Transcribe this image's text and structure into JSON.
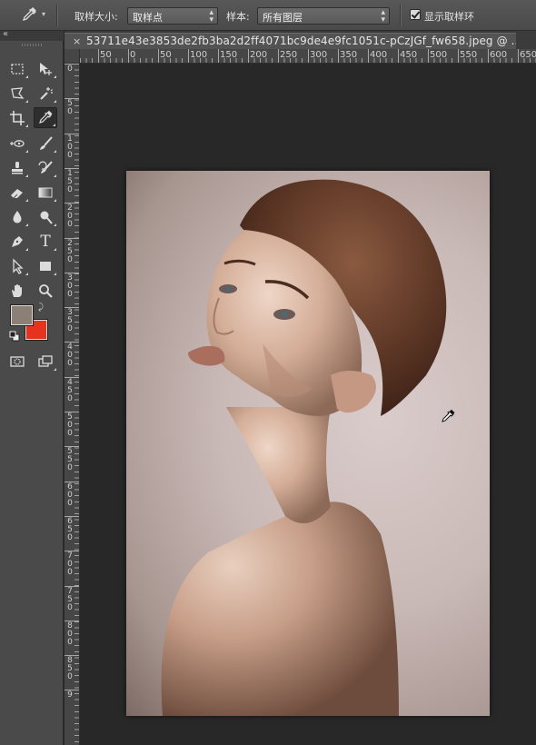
{
  "options_bar": {
    "tool_icon": "eyedropper-icon",
    "sample_size_label": "取样大小:",
    "sample_size_value": "取样点",
    "sample_label": "样本:",
    "sample_value": "所有图层",
    "show_ring_label": "显示取样环",
    "show_ring_checked": true
  },
  "document": {
    "tab_close": "×",
    "tab_title": "53711e43e3853de2fb3ba2d2ff4071bc9de4e9fc1051c-pCzJGf_fw658.jpeg @ ..."
  },
  "ruler_h": [
    "50",
    "0",
    "50",
    "100",
    "150",
    "200",
    "250",
    "300",
    "350",
    "400",
    "450",
    "500",
    "550",
    "600",
    "650"
  ],
  "ruler_v": [
    {
      "chars": [
        "0"
      ]
    },
    {
      "chars": [
        "5",
        "0"
      ]
    },
    {
      "chars": [
        "1",
        "0",
        "0"
      ]
    },
    {
      "chars": [
        "1",
        "5",
        "0"
      ]
    },
    {
      "chars": [
        "2",
        "0",
        "0"
      ]
    },
    {
      "chars": [
        "2",
        "5",
        "0"
      ]
    },
    {
      "chars": [
        "3",
        "0",
        "0"
      ]
    },
    {
      "chars": [
        "3",
        "5",
        "0"
      ]
    },
    {
      "chars": [
        "4",
        "0",
        "0"
      ]
    },
    {
      "chars": [
        "4",
        "5",
        "0"
      ]
    },
    {
      "chars": [
        "5",
        "0",
        "0"
      ]
    },
    {
      "chars": [
        "5",
        "5",
        "0"
      ]
    },
    {
      "chars": [
        "6",
        "0",
        "0"
      ]
    },
    {
      "chars": [
        "6",
        "5",
        "0"
      ]
    },
    {
      "chars": [
        "7",
        "0",
        "0"
      ]
    },
    {
      "chars": [
        "7",
        "5",
        "0"
      ]
    },
    {
      "chars": [
        "8",
        "0",
        "0"
      ]
    },
    {
      "chars": [
        "8",
        "5",
        "0"
      ]
    },
    {
      "chars": [
        "9"
      ]
    }
  ],
  "tools": [
    {
      "name": "marquee-tool",
      "icon": "rect-marquee-icon"
    },
    {
      "name": "move-tool",
      "icon": "move-icon"
    },
    {
      "name": "lasso-tool",
      "icon": "polygon-lasso-icon"
    },
    {
      "name": "magic-wand-tool",
      "icon": "magic-wand-icon"
    },
    {
      "name": "crop-tool",
      "icon": "crop-icon"
    },
    {
      "name": "eyedropper-tool",
      "icon": "eyedropper-icon"
    },
    {
      "name": "spot-healing-tool",
      "icon": "spot-healing-icon"
    },
    {
      "name": "brush-tool",
      "icon": "brush-icon"
    },
    {
      "name": "clone-stamp-tool",
      "icon": "stamp-icon"
    },
    {
      "name": "history-brush-tool",
      "icon": "history-brush-icon"
    },
    {
      "name": "eraser-tool",
      "icon": "eraser-icon"
    },
    {
      "name": "gradient-tool",
      "icon": "gradient-icon"
    },
    {
      "name": "blur-tool",
      "icon": "drop-icon"
    },
    {
      "name": "dodge-tool",
      "icon": "dodge-icon"
    },
    {
      "name": "pen-tool",
      "icon": "pen-icon"
    },
    {
      "name": "type-tool",
      "icon": "type-icon"
    },
    {
      "name": "path-selection-tool",
      "icon": "arrow-icon"
    },
    {
      "name": "rectangle-tool",
      "icon": "rectangle-icon"
    },
    {
      "name": "hand-tool",
      "icon": "hand-icon"
    },
    {
      "name": "zoom-tool",
      "icon": "zoom-icon"
    }
  ],
  "colors": {
    "foreground": "#8c7f76",
    "background": "#e7321e",
    "panel": "#4a4a4a",
    "workspace": "#282828"
  },
  "type_tool_glyph": "T"
}
